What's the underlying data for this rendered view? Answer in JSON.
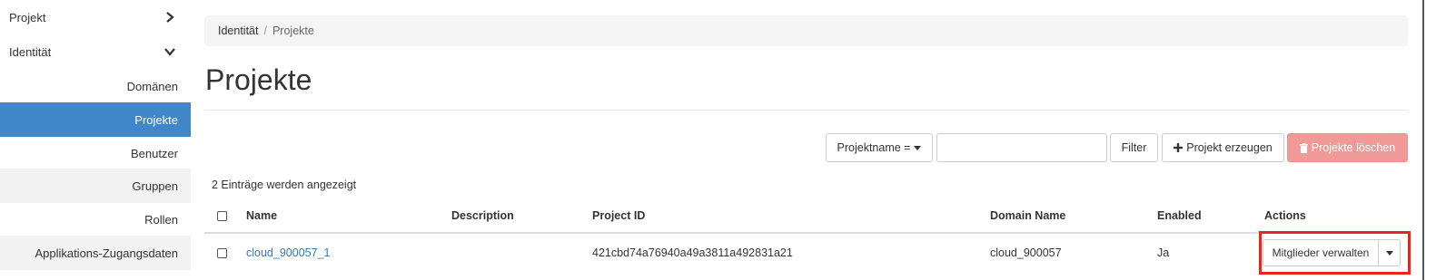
{
  "sidebar": {
    "projekt": "Projekt",
    "identitaet": "Identität",
    "items": [
      {
        "label": "Domänen"
      },
      {
        "label": "Projekte"
      },
      {
        "label": "Benutzer"
      },
      {
        "label": "Gruppen"
      },
      {
        "label": "Rollen"
      },
      {
        "label": "Applikations-Zugangsdaten"
      }
    ]
  },
  "breadcrumb": {
    "root": "Identität",
    "separator": "/",
    "current": "Projekte"
  },
  "page": {
    "title": "Projekte"
  },
  "toolbar": {
    "filter_select": "Projektname =",
    "filter_value": "",
    "filter_button": "Filter",
    "create_button": "Projekt erzeugen",
    "delete_button": "Projekte löschen"
  },
  "table": {
    "count_text": "2 Einträge werden angezeigt",
    "columns": [
      "Name",
      "Description",
      "Project ID",
      "Domain Name",
      "Enabled",
      "Actions"
    ],
    "rows": [
      {
        "name": "cloud_900057_1",
        "description": "",
        "project_id": "421cbd74a76940a49a3811a492831a21",
        "domain_name": "cloud_900057",
        "enabled": "Ja",
        "action": "Mitglieder verwalten"
      }
    ]
  },
  "colors": {
    "active_nav": "#3f87c9",
    "danger_button": "#ef9a96",
    "link": "#337ab7",
    "highlight": "#e6261f"
  }
}
